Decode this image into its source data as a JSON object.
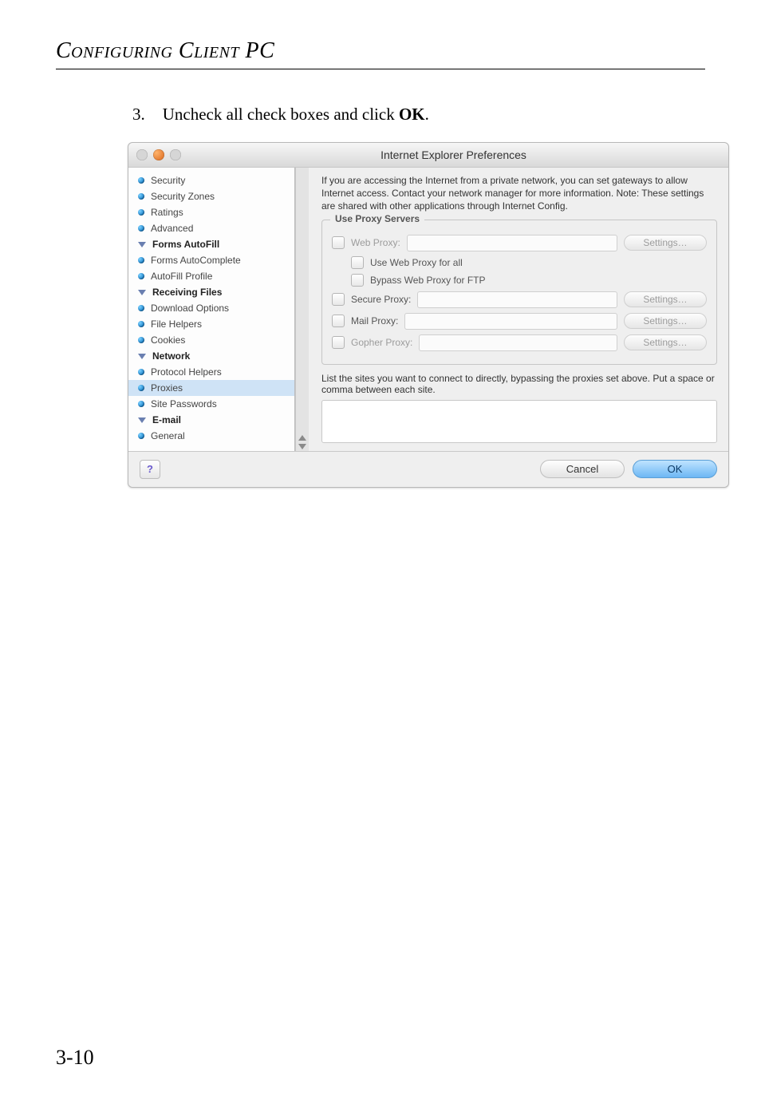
{
  "doc": {
    "heading_word1": "Configuring",
    "heading_word2": "Client",
    "heading_word3": "PC",
    "step_number": "3.",
    "step_text_pre": "Uncheck all check boxes and click ",
    "step_text_bold": "OK",
    "step_text_post": ".",
    "page_number": "3-10"
  },
  "window": {
    "title": "Internet Explorer Preferences",
    "traffic_colors": {
      "close": "#d6d6d6",
      "min": "#e0762a",
      "zoom": "#d6d6d6"
    }
  },
  "sidebar": {
    "items": [
      {
        "kind": "item",
        "label": "Security"
      },
      {
        "kind": "item",
        "label": "Security Zones"
      },
      {
        "kind": "item",
        "label": "Ratings"
      },
      {
        "kind": "item",
        "label": "Advanced"
      },
      {
        "kind": "group",
        "label": "Forms AutoFill"
      },
      {
        "kind": "item",
        "label": "Forms AutoComplete"
      },
      {
        "kind": "item",
        "label": "AutoFill Profile"
      },
      {
        "kind": "group",
        "label": "Receiving Files"
      },
      {
        "kind": "item",
        "label": "Download Options"
      },
      {
        "kind": "item",
        "label": "File Helpers"
      },
      {
        "kind": "item",
        "label": "Cookies"
      },
      {
        "kind": "group",
        "label": "Network"
      },
      {
        "kind": "item",
        "label": "Protocol Helpers"
      },
      {
        "kind": "item",
        "label": "Proxies",
        "current": true
      },
      {
        "kind": "item",
        "label": "Site Passwords"
      },
      {
        "kind": "group",
        "label": "E-mail"
      },
      {
        "kind": "item",
        "label": "General"
      }
    ]
  },
  "content": {
    "intro": "If you are accessing the Internet from a private network, you can set gateways to allow Internet access.  Contact your network manager for more information.  Note: These settings are shared with other applications through Internet Config.",
    "group_title": "Use Proxy Servers",
    "web_proxy_label": "Web Proxy:",
    "web_proxy_all": "Use Web Proxy for all",
    "bypass_ftp": "Bypass Web Proxy for FTP",
    "secure_proxy_label": "Secure Proxy:",
    "mail_proxy_label": "Mail Proxy:",
    "gopher_proxy_label": "Gopher Proxy:",
    "settings_label": "Settings…",
    "bypass_text": "List the sites you want to connect to directly,  bypassing the proxies set above.  Put a space or comma between each site."
  },
  "footer": {
    "help": "?",
    "cancel": "Cancel",
    "ok": "OK"
  }
}
